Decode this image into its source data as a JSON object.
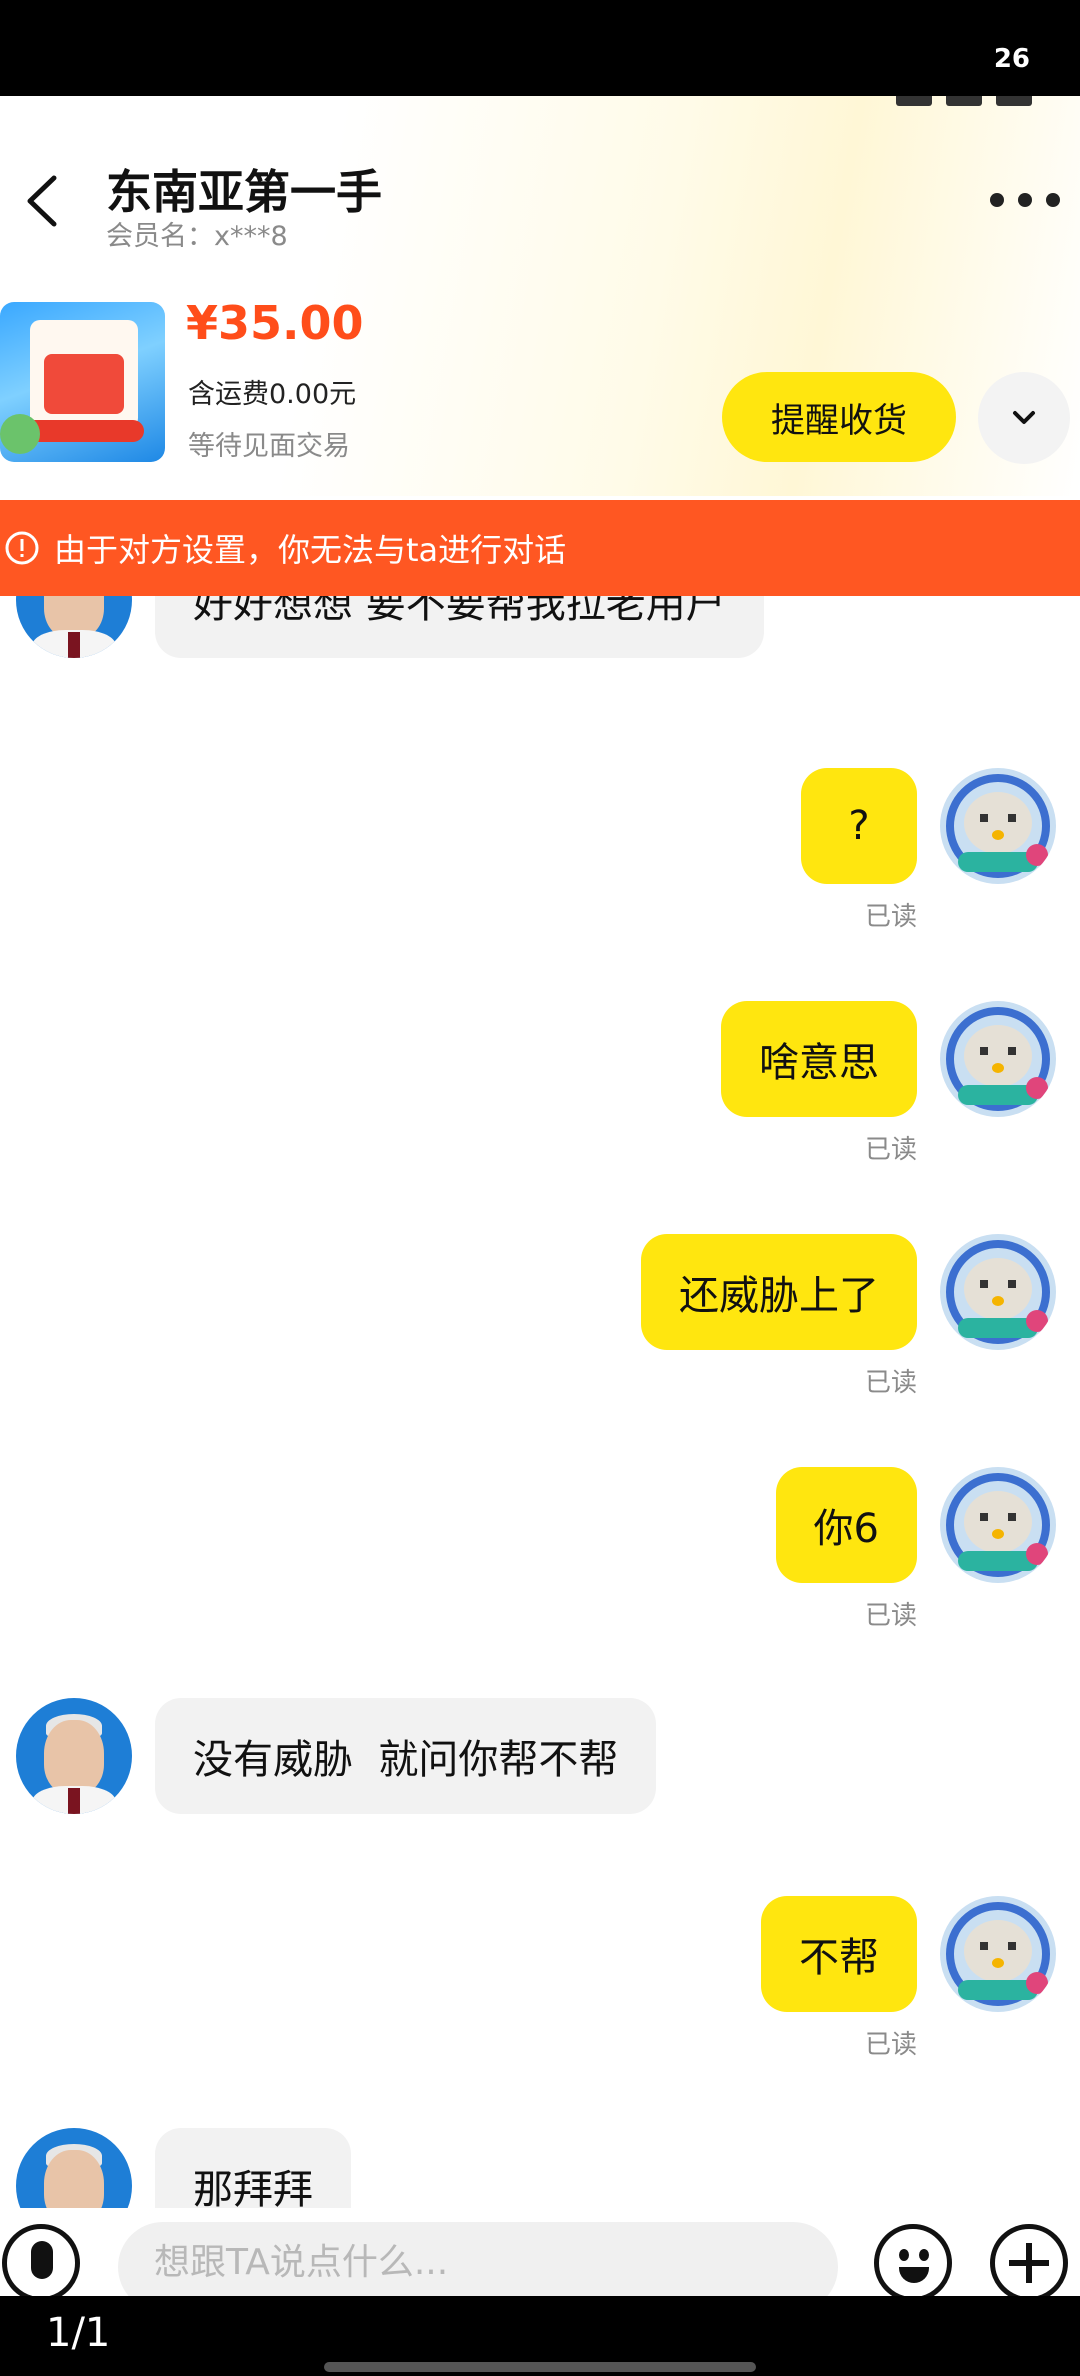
{
  "viewer": {
    "page_counter_top": "26",
    "page_indicator": "1/1"
  },
  "header": {
    "contact_name": "东南亚第一手",
    "member_name": "会员名：x***8"
  },
  "product": {
    "price": "¥35.00",
    "shipping": "含运费0.00元",
    "status": "等待见面交易",
    "remind_button": "提醒收货"
  },
  "banner": {
    "text": "由于对方设置，你无法与ta进行对话",
    "color": "#ff5722"
  },
  "messages": [
    {
      "side": "left",
      "text": "好好想想 要不要帮我拉老用户"
    },
    {
      "side": "right",
      "text": "?",
      "receipt": "已读"
    },
    {
      "side": "right",
      "text": "啥意思",
      "receipt": "已读"
    },
    {
      "side": "right",
      "text": "还威胁上了",
      "receipt": "已读"
    },
    {
      "side": "right",
      "text": "你6",
      "receipt": "已读"
    },
    {
      "side": "left",
      "text": "没有威胁  就问你帮不帮"
    },
    {
      "side": "right",
      "text": "不帮",
      "receipt": "已读"
    },
    {
      "side": "left",
      "text": "那拜拜"
    }
  ],
  "input": {
    "placeholder": "想跟TA说点什么..."
  },
  "colors": {
    "accent_yellow": "#ffe60f",
    "price_orange": "#ff4d1a"
  }
}
